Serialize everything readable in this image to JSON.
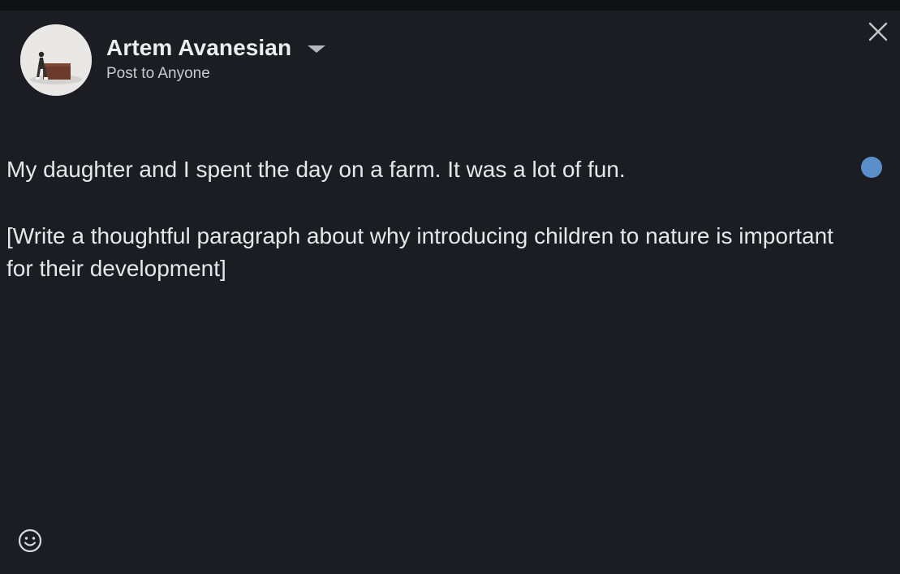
{
  "author": {
    "name": "Artem Avanesian",
    "visibility": "Post to Anyone"
  },
  "composer": {
    "paragraphs": [
      "My daughter and I spent the day on a farm. It was a lot of fun.",
      "[Write a thoughtful paragraph about why introducing children to nature is important for their development]"
    ]
  },
  "icons": {
    "close": "close-icon",
    "dropdown": "chevron-down-icon",
    "emoji": "emoji-icon",
    "status": "status-dot"
  },
  "colors": {
    "background": "#1b1d22",
    "text": "#e6e7ea",
    "accent": "#5a8fca"
  }
}
